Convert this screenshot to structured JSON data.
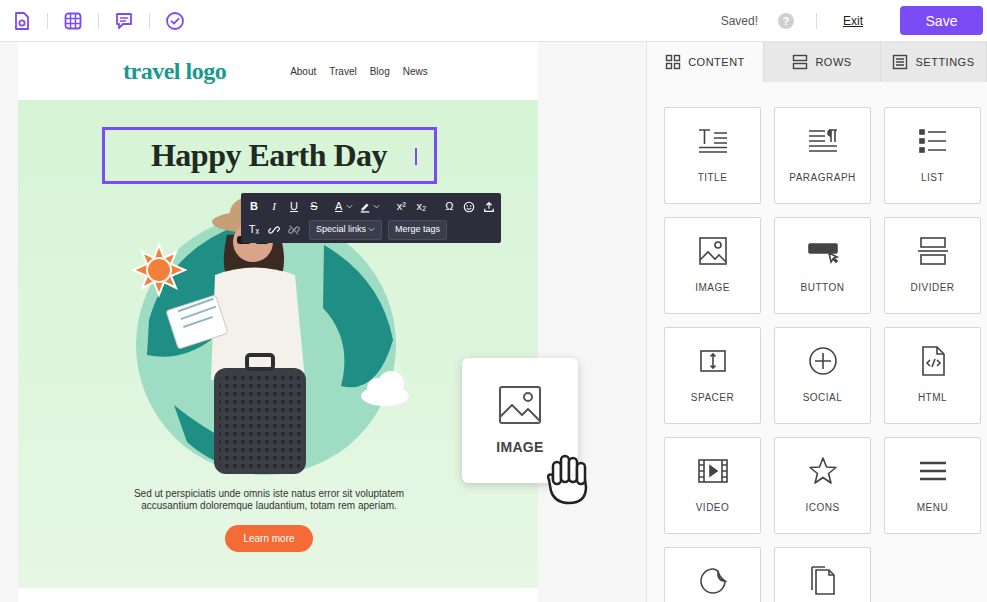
{
  "topbar": {
    "status": "Saved!",
    "help": "?",
    "exit": "Exit",
    "save": "Save"
  },
  "email": {
    "logo": "travel logo",
    "nav": [
      "About",
      "Travel",
      "Blog",
      "News"
    ],
    "title": "Happy Earth Day",
    "title_selected": true,
    "body": "Sed ut perspiciatis unde omnis iste natus error sit voluptatem accusantium doloremque laudantium, totam rem aperiam.",
    "button": "Learn more"
  },
  "editor_toolbar": {
    "rows": [
      [
        [
          {
            "kind": "bold",
            "label": "B"
          },
          {
            "kind": "italic",
            "label": "I"
          },
          {
            "kind": "underline",
            "label": "U"
          },
          {
            "kind": "strike",
            "label": "S"
          }
        ],
        [
          {
            "kind": "color",
            "label": "A",
            "dropdown": true
          },
          {
            "kind": "highlight",
            "label": "",
            "dropdown": true
          }
        ],
        [
          {
            "kind": "superscript",
            "label": "x²",
            "dropdown": false
          },
          {
            "kind": "subscript",
            "label": "x₂",
            "dropdown": false
          }
        ],
        [
          {
            "kind": "symbol",
            "label": "Ω",
            "dropdown": false
          },
          {
            "kind": "emoji",
            "label": "",
            "dropdown": false
          },
          {
            "kind": "upload",
            "label": "",
            "dropdown": false
          }
        ]
      ],
      [
        [
          {
            "kind": "clear",
            "label": "Tₓ",
            "dropdown": false
          },
          {
            "kind": "link",
            "label": "",
            "dropdown": false
          },
          {
            "kind": "unlink",
            "label": "",
            "dropdown": false
          },
          {
            "kind": "menu",
            "label": "Special links",
            "dropdown": true
          },
          {
            "kind": "menu",
            "label": "Merge tags",
            "dropdown": false
          }
        ]
      ]
    ]
  },
  "drag_preview": {
    "label": "IMAGE"
  },
  "panel": {
    "tabs": [
      {
        "label": "CONTENT",
        "kind": "content",
        "selected": true
      },
      {
        "label": "ROWS",
        "kind": "rows",
        "selected": false
      },
      {
        "label": "SETTINGS",
        "kind": "settings",
        "selected": false
      }
    ],
    "tiles": [
      {
        "label": "TITLE",
        "kind": "title"
      },
      {
        "label": "PARAGRAPH",
        "kind": "paragraph"
      },
      {
        "label": "LIST",
        "kind": "list"
      },
      {
        "label": "IMAGE",
        "kind": "image"
      },
      {
        "label": "BUTTON",
        "kind": "button"
      },
      {
        "label": "DIVIDER",
        "kind": "divider"
      },
      {
        "label": "SPACER",
        "kind": "spacer"
      },
      {
        "label": "SOCIAL",
        "kind": "social"
      },
      {
        "label": "HTML",
        "kind": "html"
      },
      {
        "label": "VIDEO",
        "kind": "video"
      },
      {
        "label": "ICONS",
        "kind": "icons"
      },
      {
        "label": "MENU",
        "kind": "menu"
      },
      {
        "label": "",
        "kind": "sticker"
      },
      {
        "label": "",
        "kind": "page"
      }
    ]
  }
}
